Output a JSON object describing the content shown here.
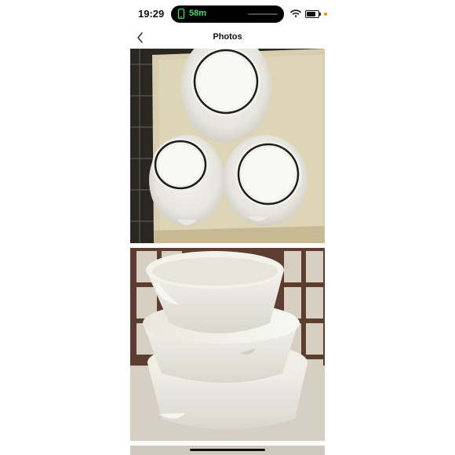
{
  "status_bar": {
    "time": "19:29",
    "call_duration": "58m",
    "icons": [
      "phone-icon",
      "wifi-icon",
      "battery-icon"
    ],
    "battery_level": 0.75,
    "accent_call": "#3ddc6a",
    "accent_dot": "#ff8a00"
  },
  "nav": {
    "title": "Photos",
    "back_icon": "chevron-left-icon"
  },
  "photos": {
    "count_visible": 3
  }
}
